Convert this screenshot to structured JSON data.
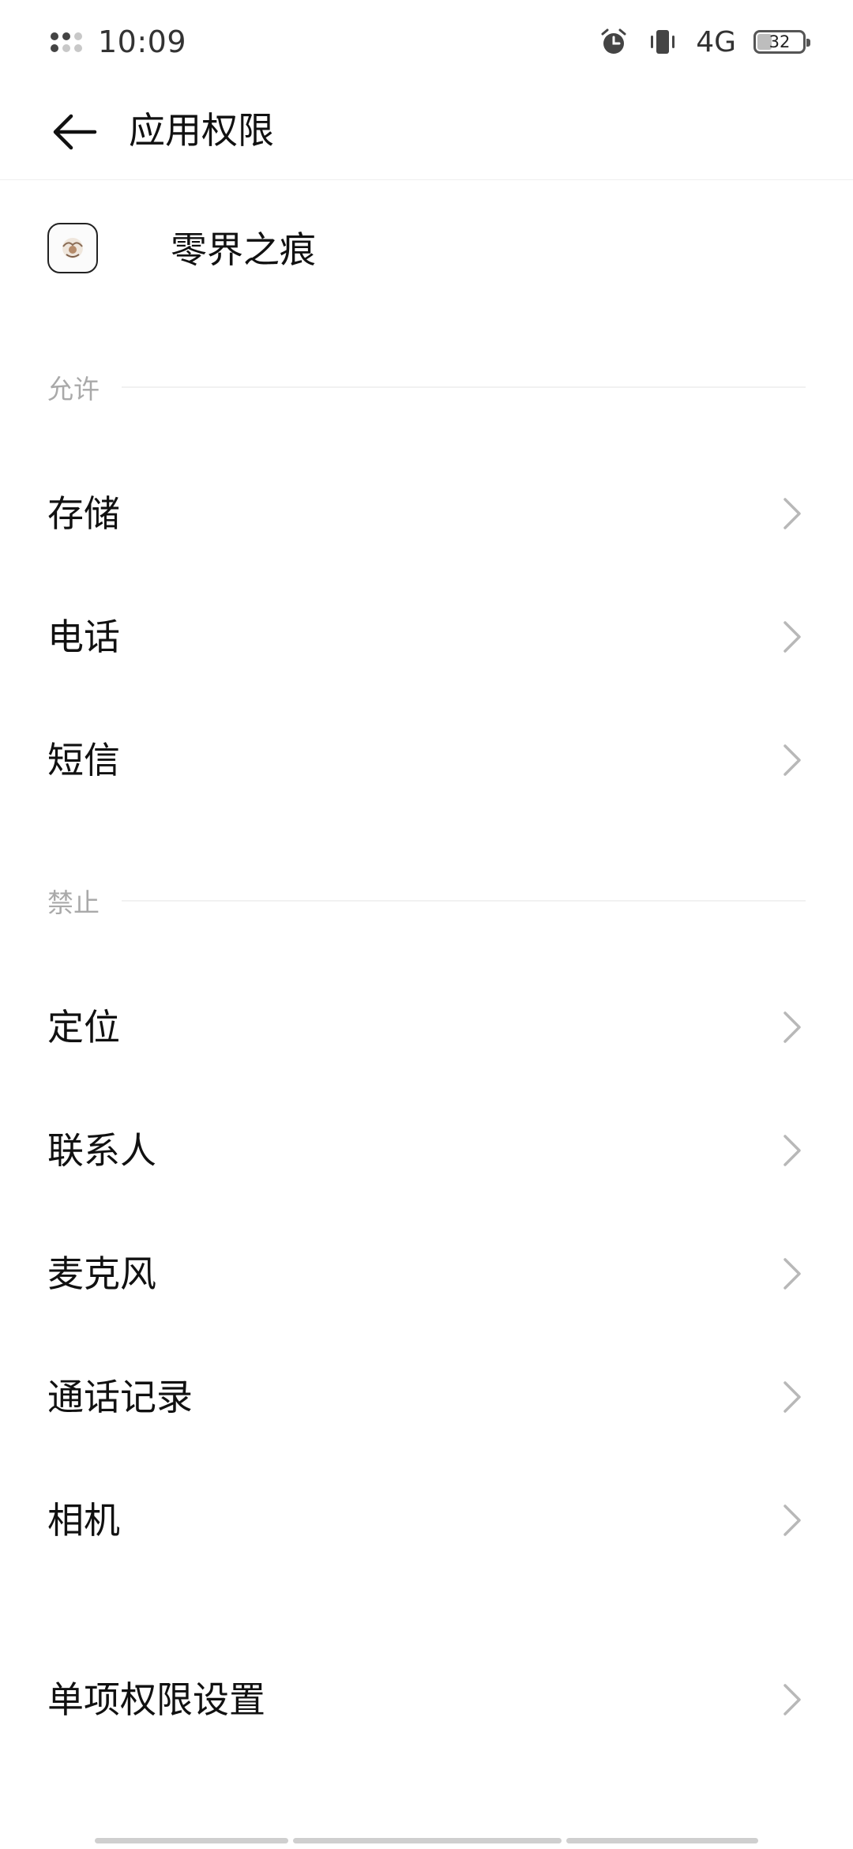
{
  "status_bar": {
    "time": "10:09",
    "network": "4G",
    "battery": "32",
    "battery_level": 0.32
  },
  "header": {
    "title": "应用权限"
  },
  "app": {
    "name": "零界之痕"
  },
  "sections": {
    "allowed_label": "允许",
    "denied_label": "禁止"
  },
  "allowed": [
    "存储",
    "电话",
    "短信"
  ],
  "denied": [
    "定位",
    "联系人",
    "麦克风",
    "通话记录",
    "相机"
  ],
  "individual_settings": "单项权限设置",
  "colors": {
    "text": "#111111",
    "section_label": "#a9a9a9",
    "chevron": "#b8b8b8",
    "divider": "#f1f1f1"
  }
}
